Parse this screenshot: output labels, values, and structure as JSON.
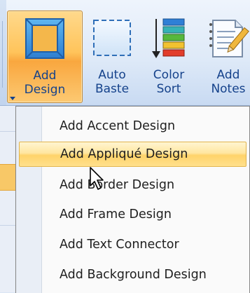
{
  "ribbon": {
    "buttons": [
      {
        "label_line1": "Add",
        "label_line2": "Design",
        "icon": "add-design-icon",
        "has_dropdown": true,
        "pressed": true
      },
      {
        "label_line1": "Auto",
        "label_line2": "Baste",
        "icon": "auto-baste-icon",
        "has_dropdown": false,
        "pressed": false
      },
      {
        "label_line1": "Color",
        "label_line2": "Sort",
        "icon": "color-sort-icon",
        "has_dropdown": false,
        "pressed": false
      },
      {
        "label_line1": "Add",
        "label_line2": "Notes",
        "icon": "add-notes-icon",
        "has_dropdown": false,
        "pressed": false
      }
    ]
  },
  "menu": {
    "items": [
      {
        "label": "Add Accent Design"
      },
      {
        "label": "Add Appliqué Design",
        "hovered": true
      },
      {
        "label": "Add Border Design"
      },
      {
        "label": "Add Frame Design"
      },
      {
        "label": "Add Text Connector"
      },
      {
        "label": "Add Background Design"
      }
    ]
  },
  "colors": {
    "pressed_button": "#ffc45b",
    "hover_item": "#ffd36a",
    "ribbon_text": "#15428b",
    "menu_text": "#1e1e1e"
  }
}
